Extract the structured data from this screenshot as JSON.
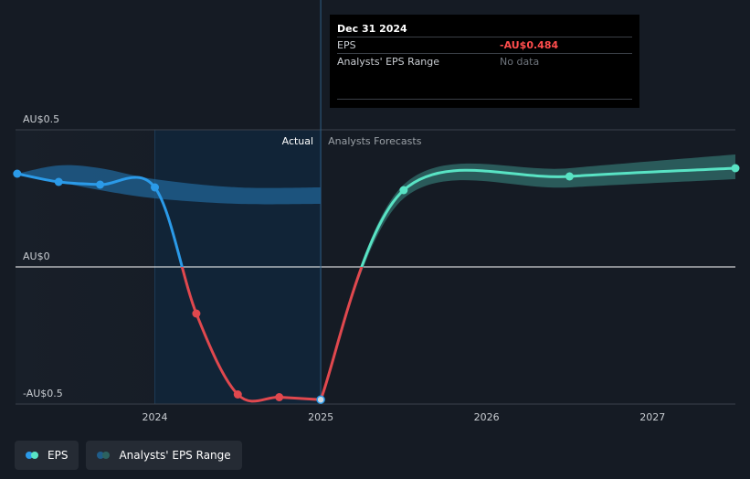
{
  "chart_data": {
    "type": "line",
    "y_ticks": [
      {
        "value": 0.5,
        "label": "AU$0.5"
      },
      {
        "value": 0,
        "label": "AU$0"
      },
      {
        "value": -0.5,
        "label": "-AU$0.5"
      }
    ],
    "x_ticks": [
      {
        "value": 2024,
        "label": "2024"
      },
      {
        "value": 2025,
        "label": "2025"
      },
      {
        "value": 2026,
        "label": "2026"
      },
      {
        "value": 2027,
        "label": "2027"
      }
    ],
    "xlim": [
      2023.16,
      2027.5
    ],
    "ylim": [
      -0.5,
      0.5
    ],
    "divider_x": 2025.0,
    "highlight_range": [
      2024.0,
      2025.0
    ],
    "section_labels": {
      "actual": "Actual",
      "forecast": "Analysts Forecasts"
    },
    "series": [
      {
        "name": "EPS",
        "kind": "actual",
        "points": [
          {
            "x": 2023.17,
            "y": 0.34
          },
          {
            "x": 2023.42,
            "y": 0.31
          },
          {
            "x": 2023.67,
            "y": 0.3
          },
          {
            "x": 2024.0,
            "y": 0.29
          },
          {
            "x": 2024.25,
            "y": -0.17
          },
          {
            "x": 2024.5,
            "y": -0.465
          },
          {
            "x": 2024.75,
            "y": -0.475
          },
          {
            "x": 2025.0,
            "y": -0.484
          }
        ]
      },
      {
        "name": "EPS",
        "kind": "forecast",
        "points": [
          {
            "x": 2025.0,
            "y": -0.484
          },
          {
            "x": 2025.5,
            "y": 0.28
          },
          {
            "x": 2026.5,
            "y": 0.33
          },
          {
            "x": 2027.5,
            "y": 0.36
          }
        ]
      }
    ],
    "range_band_actual": {
      "x": [
        2023.17,
        2023.42,
        2023.67,
        2024.0,
        2024.5,
        2025.0
      ],
      "upper": [
        0.34,
        0.37,
        0.36,
        0.32,
        0.29,
        0.29
      ],
      "lower": [
        0.34,
        0.31,
        0.28,
        0.25,
        0.23,
        0.23
      ]
    },
    "range_band_forecast": {
      "x": [
        2025.0,
        2025.5,
        2026.5,
        2027.5
      ],
      "upper": [
        -0.484,
        0.3,
        0.36,
        0.41
      ],
      "lower": [
        -0.484,
        0.25,
        0.29,
        0.32
      ]
    },
    "colors": {
      "background": "#151b24",
      "highlight": "#112437",
      "eps_positive": "#2b9ae8",
      "eps_negative": "#e0484e",
      "forecast_line": "#59e3c4",
      "band_actual": "#1f5c89",
      "band_forecast": "#2c6260",
      "zero_line": "#ffffff",
      "grid_line": "#3a414b",
      "tick_label": "#c9cdd2"
    }
  },
  "tooltip": {
    "date": "Dec 31 2024",
    "rows": [
      {
        "label": "EPS",
        "value": "-AU$0.484"
      },
      {
        "label": "Analysts' EPS Range",
        "value": "No data"
      }
    ]
  },
  "legend": {
    "items": [
      {
        "label": "EPS",
        "colors": [
          "#2b9ae8",
          "#59e3c4"
        ]
      },
      {
        "label": "Analysts' EPS Range",
        "colors": [
          "#1f5c89",
          "#2c6260"
        ]
      }
    ]
  }
}
